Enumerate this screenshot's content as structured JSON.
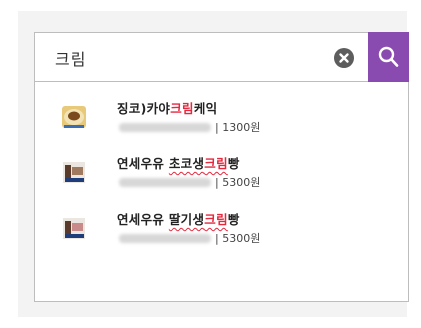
{
  "search": {
    "query": "크림"
  },
  "results": [
    {
      "title_prefix": "징코)카야",
      "title_highlight": "크림",
      "title_suffix": "케익",
      "price": "| 1300원",
      "underlined": false
    },
    {
      "title_prefix": "연세우유 ",
      "title_highlight_pre": "초코생",
      "title_highlight": "크림",
      "title_suffix": "빵",
      "price": "| 5300원",
      "underlined": true
    },
    {
      "title_prefix": "연세우유 ",
      "title_highlight_pre": "딸기생",
      "title_highlight": "크림",
      "title_suffix": "빵",
      "price": "| 5300원",
      "underlined": true
    }
  ],
  "colors": {
    "accent": "#8a4bb0",
    "highlight": "#e5283e",
    "clear": "#5d5d5d"
  },
  "icons": {
    "clear": "close-circle-icon",
    "search": "magnifier-icon"
  }
}
